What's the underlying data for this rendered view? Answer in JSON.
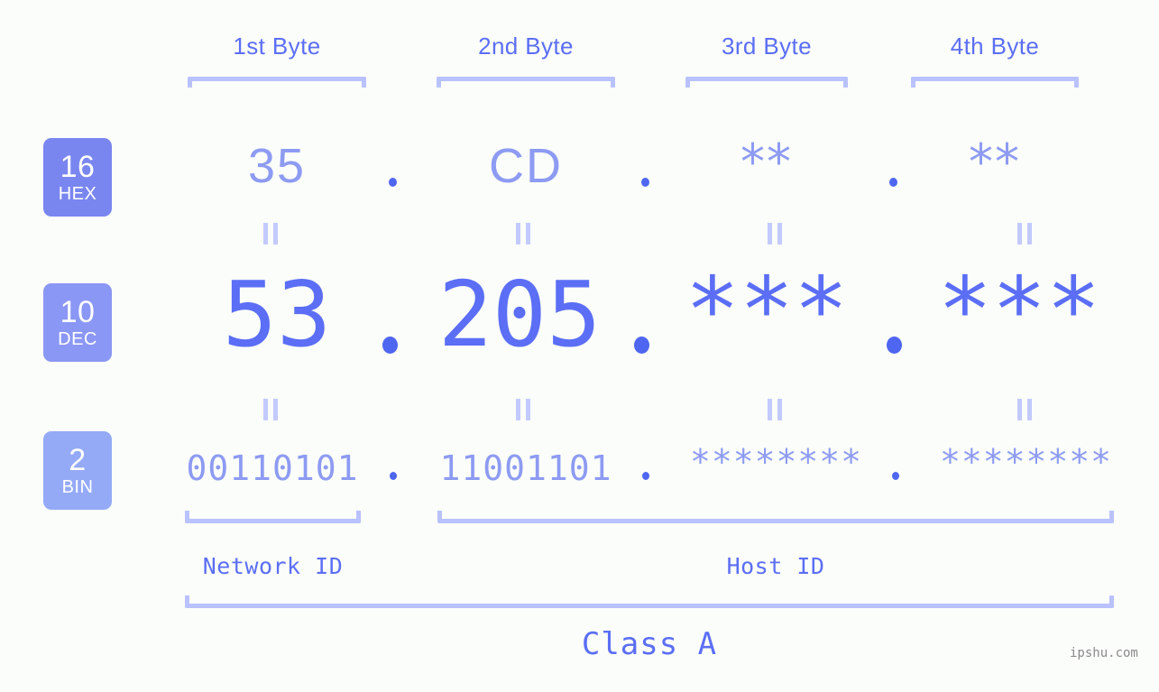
{
  "meta": {
    "background_color": "#fbfdfa",
    "accent_color": "#5b6ef5",
    "accent_light_color": "#8d9bf2",
    "bracket_color": "#b9c2ff",
    "watermark": "ipshu.com"
  },
  "byte_headers": [
    {
      "label": "1st Byte"
    },
    {
      "label": "2nd Byte"
    },
    {
      "label": "3rd Byte"
    },
    {
      "label": "4th Byte"
    }
  ],
  "bases": [
    {
      "num": "16",
      "name": "HEX",
      "color": "#7986f0"
    },
    {
      "num": "10",
      "name": "DEC",
      "color": "#8b97f4"
    },
    {
      "num": "2",
      "name": "BIN",
      "color": "#94aaf7"
    }
  ],
  "rows": {
    "hex": {
      "base_num": "16",
      "base_name": "HEX",
      "values": [
        "35",
        "CD",
        "**",
        "**"
      ],
      "separator": "."
    },
    "dec": {
      "base_num": "10",
      "base_name": "DEC",
      "values": [
        "53",
        "205",
        "***",
        "***"
      ],
      "separator": "."
    },
    "bin": {
      "base_num": "2",
      "base_name": "BIN",
      "values": [
        "00110101",
        "11001101",
        "********",
        "********"
      ],
      "separator": "."
    }
  },
  "id_labels": [
    {
      "label": "Network ID"
    },
    {
      "label": "Host ID"
    }
  ],
  "class_label": "Class A"
}
